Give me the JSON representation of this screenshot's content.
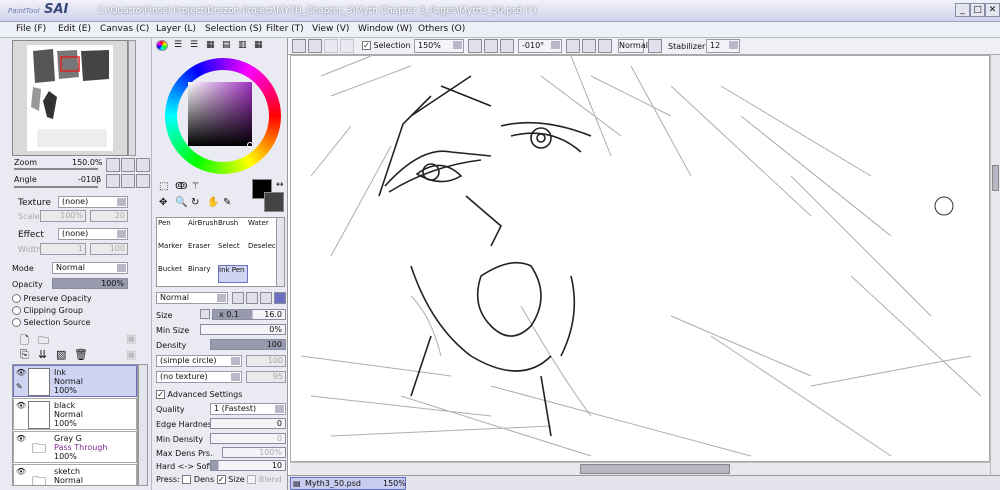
{
  "app": {
    "logo_brand": "PaintTool",
    "logo_name": "SAI",
    "title": "C:\\Quatro\\Pinsel Project\\Drazon-Project\\MYTH_Chapter_3\\Myth Chapter 3_Pages\\Myth3_50.psd (*)"
  },
  "window_buttons": [
    "_",
    "□",
    "✕"
  ],
  "menu": [
    "File (F)",
    "Edit (E)",
    "Canvas (C)",
    "Layer (L)",
    "Selection (S)",
    "Filter (T)",
    "View (V)",
    "Window (W)",
    "Others (O)"
  ],
  "toolbar": {
    "selection_label": "Selection",
    "selection_checked": true,
    "zoom": "150%",
    "angle": "-010°",
    "blend": "Normal",
    "stabilizer_label": "Stabilizer",
    "stabilizer_value": "12"
  },
  "navigator": {
    "zoom_label": "Zoom",
    "zoom_value": "150.0%",
    "angle_label": "Angle",
    "angle_value": "-010β"
  },
  "layer_props": {
    "texture_label": "Texture",
    "texture_value": "(none)",
    "scale_label": "Scale",
    "scale_value": "100%",
    "scale_num": "20",
    "effect_label": "Effect",
    "effect_value": "(none)",
    "width_label": "Width",
    "width_value": "1",
    "width_num": "100",
    "mode_label": "Mode",
    "mode_value": "Normal",
    "opacity_label": "Opacity",
    "opacity_value": "100%",
    "opacity_fill": 1.0,
    "preserve_opacity": "Preserve Opacity",
    "clipping_group": "Clipping Group",
    "selection_source": "Selection Source"
  },
  "layers": [
    {
      "name": "Ink",
      "mode": "Normal",
      "opacity": "100%",
      "selected": true,
      "folder": false
    },
    {
      "name": "black",
      "mode": "Normal",
      "opacity": "100%",
      "selected": false,
      "folder": false
    },
    {
      "name": "Gray G",
      "mode": "Pass Through",
      "opacity": "100%",
      "selected": false,
      "folder": true
    },
    {
      "name": "sketch",
      "mode": "Normal",
      "opacity": "",
      "selected": false,
      "folder": true
    }
  ],
  "tools": [
    [
      "Pen",
      "AirBrush",
      "Brush",
      "Water"
    ],
    [
      "Marker",
      "Eraser",
      "Select",
      "Deselect"
    ],
    [
      "Bucket",
      "Binary",
      "Ink Pen",
      ""
    ]
  ],
  "selected_tool": "Ink Pen",
  "brush": {
    "blend": "Normal",
    "size_label": "Size",
    "size_mult": "x 0.1",
    "size_value": "16.0",
    "size_fill": 0.55,
    "minsize_label": "Min Size",
    "minsize_value": "0%",
    "density_label": "Density",
    "density_value": "100",
    "shape": "(simple circle)",
    "shape_num": "100",
    "texture": "(no texture)",
    "texture_num": "95",
    "advanced_label": "Advanced Settings",
    "quality_label": "Quality",
    "quality_value": "1 (Fastest)",
    "edge_label": "Edge Hardness",
    "edge_value": "0",
    "mindens_label": "Min Density",
    "mindens_value": "0",
    "maxdens_label": "Max Dens Prs.",
    "maxdens_value": "100%",
    "hardsoft_label": "Hard <-> Soft",
    "hardsoft_value": "10",
    "press_label": "Press:",
    "press_dens": "Dens",
    "press_size": "Size",
    "press_blend": "Blend"
  },
  "status": {
    "doc_name": "Myth3_50.psd",
    "doc_zoom": "150%"
  },
  "colors": {
    "primary": "#000000",
    "secondary": "#444444",
    "accent": "#6a70c0"
  }
}
